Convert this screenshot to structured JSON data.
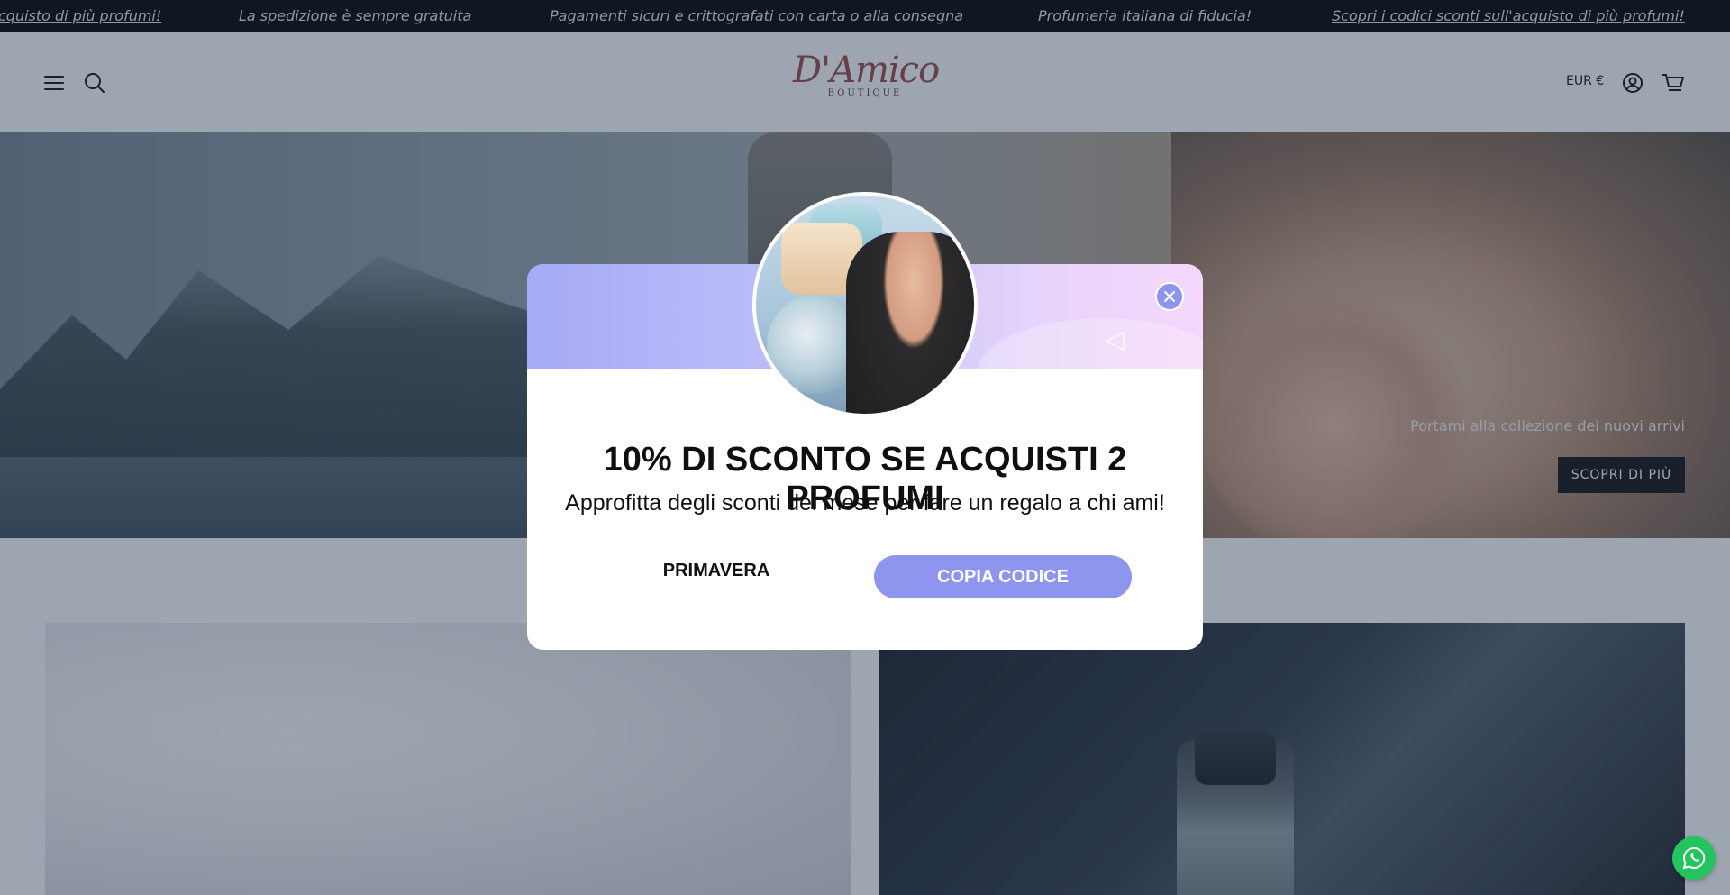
{
  "announcement": {
    "messages": [
      "cquisto di più profumi!",
      "La spedizione è sempre gratuita",
      "Pagamenti sicuri e crittografati con carta o alla consegna",
      "Profumeria italiana di fiducia!",
      "Scopri i codici sconti sull'acquisto di più profumi!"
    ]
  },
  "header": {
    "logo_script": "D'Amico",
    "logo_sub": "BOUTIQUE",
    "currency": "EUR €",
    "icons": [
      "menu-icon",
      "search-icon",
      "account-icon",
      "cart-icon"
    ]
  },
  "hero": {
    "caption": "Portami alla collezione dei nuovi arrivi",
    "button": "SCOPRI DI PIÙ"
  },
  "popup": {
    "title": "10% DI SCONTO SE ACQUISTI 2 PROFUMI",
    "subtitle": "Approfitta degli sconti del mese per fare un regalo a chi ami!",
    "code": "PRIMAVERA",
    "copy_button": "COPIA CODICE",
    "accent_color": "#8d95ee"
  },
  "whatsapp": {
    "icon": "whatsapp-icon",
    "color": "#23c45e"
  }
}
